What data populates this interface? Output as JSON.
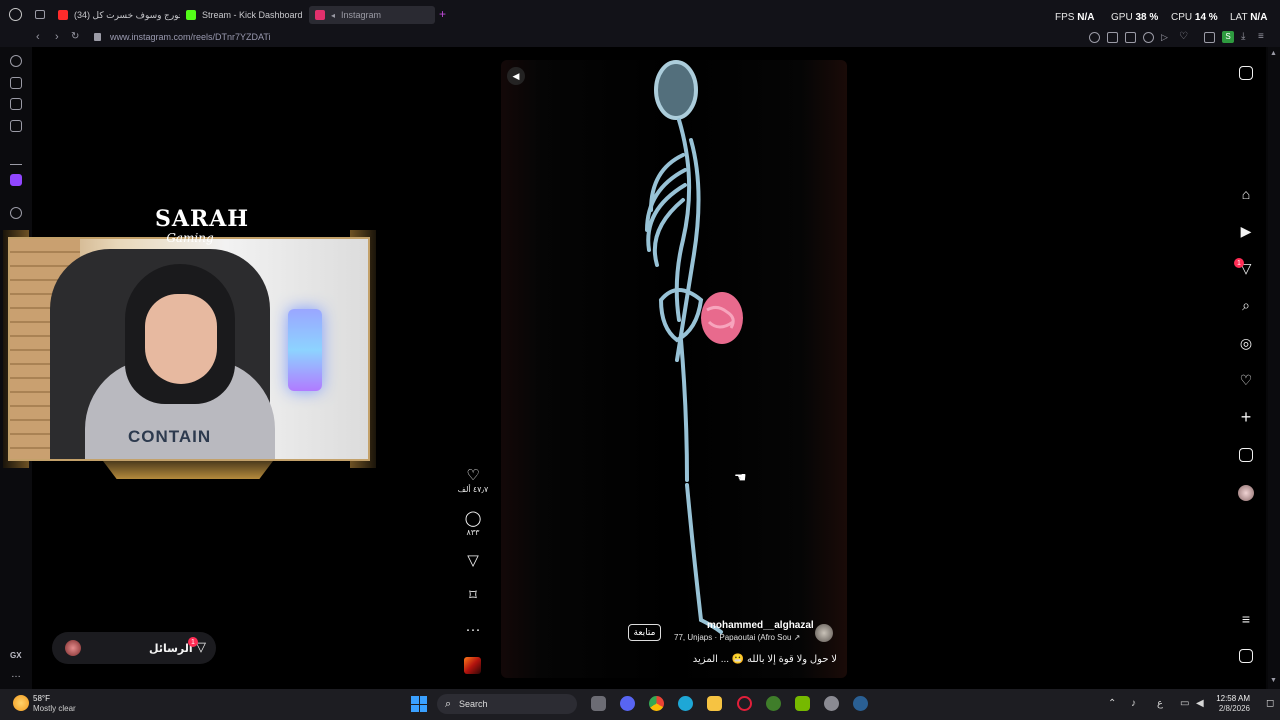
{
  "browser": {
    "tabs": [
      {
        "label": "(34) جورج وسوف خسرت كل",
        "color": "#ff2b2b"
      },
      {
        "label": "Stream - Kick Dashboard",
        "color": "#53fc18"
      },
      {
        "label": "Instagram",
        "color": "#e1306c"
      }
    ],
    "url": "www.instagram.com/reels/DTnr7YZDATi",
    "stats": {
      "fps_label": "FPS",
      "fps_value": "N/A",
      "gpu_label": "GPU",
      "gpu_value": "38 %",
      "cpu_label": "CPU",
      "cpu_value": "14 %",
      "lat_label": "LAT",
      "lat_value": "N/A"
    },
    "sidebar_label": "GX"
  },
  "overlay": {
    "logo_main": "SARAH",
    "logo_sub": "Gaming",
    "hoodie_print": "CONTAIN"
  },
  "reel": {
    "username": "mohammed__alghazal",
    "music": "77, Unjaps · Papaoutai (Afro Sou ↗",
    "follow_label": "متابعة",
    "caption": "لا حول ولا قوة إلا بالله 😬 ... المزيد",
    "likes": "٤٧٫٧ ألف",
    "comments": "٨٣٣"
  },
  "messages": {
    "label": "الرسائل",
    "badge": "1"
  },
  "ig_nav": {
    "badge": "1"
  },
  "taskbar": {
    "weather_temp": "58°F",
    "weather_desc": "Mostly clear",
    "search_label": "Search",
    "time": "12:58 AM",
    "date": "2/8/2026",
    "lang": "ع"
  }
}
